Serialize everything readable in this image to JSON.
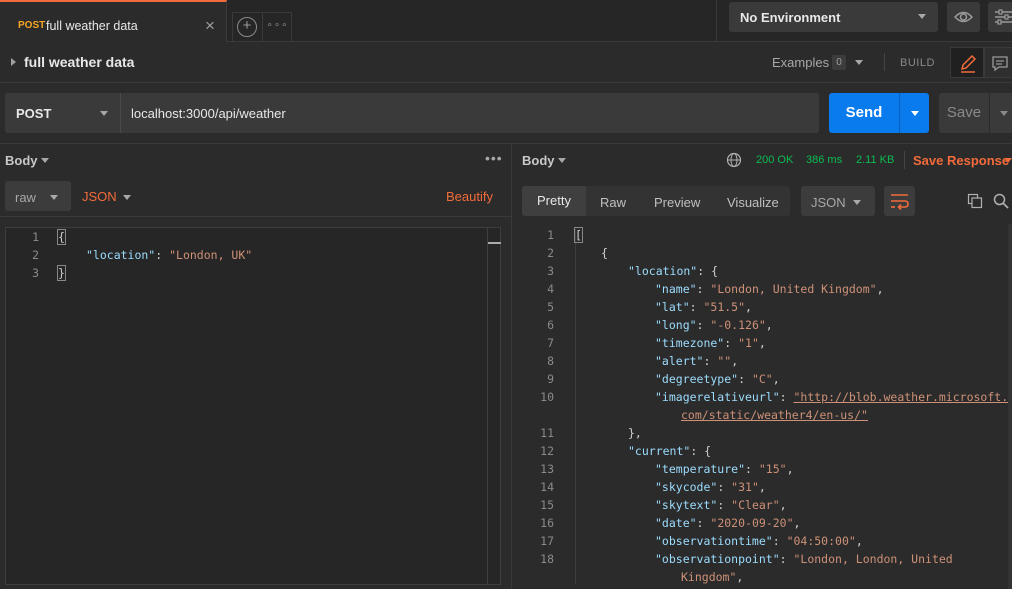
{
  "tabs": {
    "active": {
      "method": "POST",
      "title": "full weather data"
    },
    "close_glyph": "×",
    "new_tab_glyph": "+",
    "more_glyph": "∘∘∘"
  },
  "environment": {
    "label": "No Environment"
  },
  "request": {
    "name": "full weather data",
    "examples_label": "Examples",
    "examples_count": "0",
    "build_label": "BUILD",
    "method": "POST",
    "url": "localhost:3000/api/weather",
    "send_label": "Send",
    "save_label": "Save"
  },
  "request_body": {
    "label": "Body",
    "more_glyph": "•••",
    "mode": "raw",
    "format": "JSON",
    "beautify_label": "Beautify",
    "lines": [
      {
        "n": "1",
        "text": "{"
      },
      {
        "n": "2",
        "key": "\"location\"",
        "value": "\"London, UK\""
      },
      {
        "n": "3",
        "text": "}"
      }
    ]
  },
  "response": {
    "label": "Body",
    "status": "200 OK",
    "time": "386 ms",
    "size": "2.11 KB",
    "save_label": "Save Response",
    "view_tabs": [
      "Pretty",
      "Raw",
      "Preview",
      "Visualize"
    ],
    "format": "JSON",
    "line_numbers": [
      "1",
      "2",
      "3",
      "4",
      "5",
      "6",
      "7",
      "8",
      "9",
      "10",
      "11",
      "12",
      "13",
      "14",
      "15",
      "16",
      "17",
      "18"
    ],
    "lines": {
      "l1": "[",
      "l2": "{",
      "l3_key": "\"location\"",
      "l3_rest": ": {",
      "l4_key": "\"name\"",
      "l4_val": "\"London, United Kingdom\"",
      "l5_key": "\"lat\"",
      "l5_val": "\"51.5\"",
      "l6_key": "\"long\"",
      "l6_val": "\"-0.126\"",
      "l7_key": "\"timezone\"",
      "l7_val": "\"1\"",
      "l8_key": "\"alert\"",
      "l8_val": "\"\"",
      "l9_key": "\"degreetype\"",
      "l9_val": "\"C\"",
      "l10_key": "\"imagerelativeurl\"",
      "l10_val_a": "\"http://blob.weather.microsoft.",
      "l10_val_b": "com/static/weather4/en-us/\"",
      "l11": "},",
      "l12_key": "\"current\"",
      "l12_rest": ": {",
      "l13_key": "\"temperature\"",
      "l13_val": "\"15\"",
      "l14_key": "\"skycode\"",
      "l14_val": "\"31\"",
      "l15_key": "\"skytext\"",
      "l15_val": "\"Clear\"",
      "l16_key": "\"date\"",
      "l16_val": "\"2020-09-20\"",
      "l17_key": "\"observationtime\"",
      "l17_val": "\"04:50:00\"",
      "l18_key": "\"observationpoint\"",
      "l18_val_a": "\"London, London, United",
      "l18_val_b": "Kingdom\""
    }
  },
  "colors": {
    "accent": "#f26b3a",
    "send": "#097bed",
    "status_ok": "#0cbb52",
    "json_key": "#9cdcfe",
    "json_string": "#ce9178"
  }
}
